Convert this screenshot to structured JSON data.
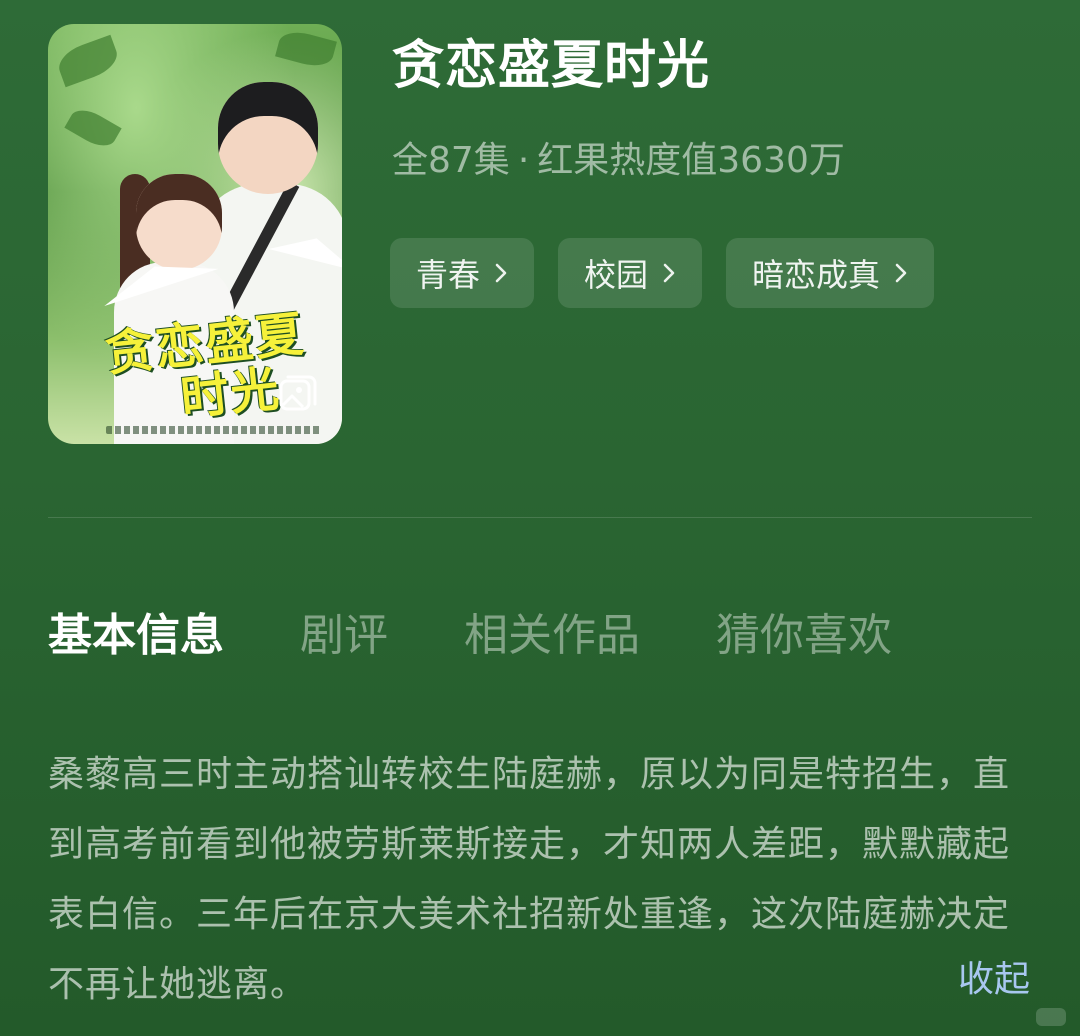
{
  "drama": {
    "title": "贪恋盛夏时光",
    "episodes": "全87集",
    "separator": "·",
    "popularity": "红果热度值3630万",
    "poster": {
      "art_line1": "贪恋盛夏",
      "art_line2": "时光",
      "gallery_icon": "image-gallery-icon"
    }
  },
  "tags": [
    {
      "label": "青春",
      "icon": "chevron-right-icon"
    },
    {
      "label": "校园",
      "icon": "chevron-right-icon"
    },
    {
      "label": "暗恋成真",
      "icon": "chevron-right-icon"
    }
  ],
  "tabs": [
    {
      "label": "基本信息",
      "active": true
    },
    {
      "label": "剧评",
      "active": false
    },
    {
      "label": "相关作品",
      "active": false
    },
    {
      "label": "猜你喜欢",
      "active": false
    }
  ],
  "synopsis": {
    "text": "桑藜高三时主动搭讪转校生陆庭赫，原以为同是特招生，直到高考前看到他被劳斯莱斯接走，才知两人差距，默默藏起表白信。三年后在京大美术社招新处重逢，这次陆庭赫决定不再让她逃离。",
    "collapse_label": "收起"
  },
  "colors": {
    "background": "#2a6532",
    "accent_link": "#a8c7ef",
    "poster_title": "#f6f13a"
  }
}
